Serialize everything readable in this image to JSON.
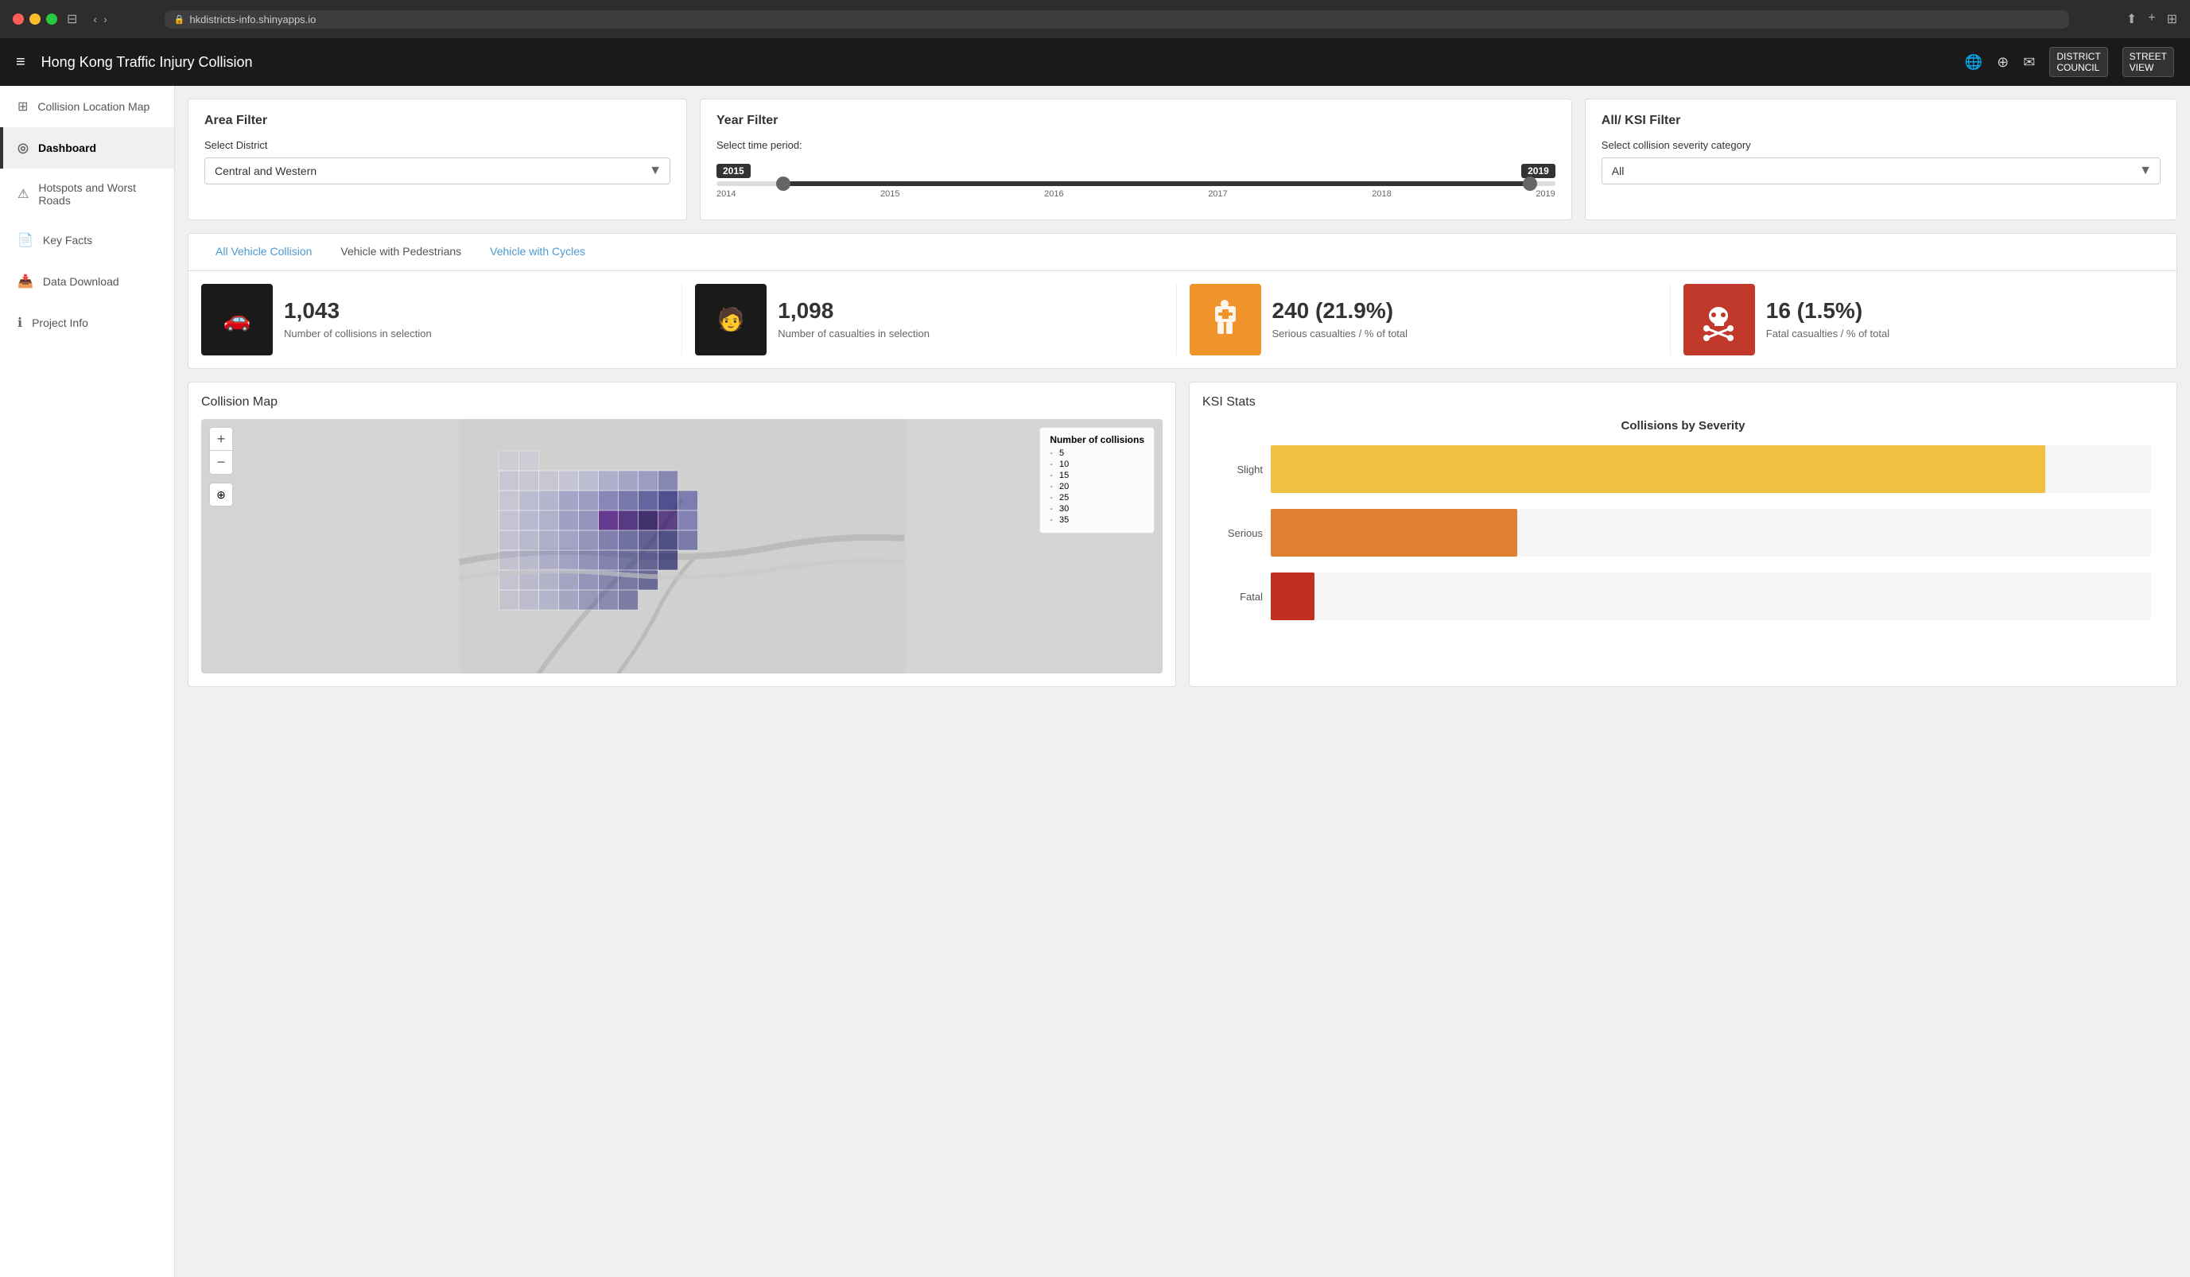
{
  "browser": {
    "url": "hkdistricts-info.shinyapps.io",
    "back_label": "‹",
    "forward_label": "›"
  },
  "topbar": {
    "title": "Hong Kong Traffic Injury Collision",
    "hamburger": "≡"
  },
  "sidebar": {
    "items": [
      {
        "id": "collision-location-map",
        "label": "Collision Location Map",
        "icon": "⊞",
        "active": false
      },
      {
        "id": "dashboard",
        "label": "Dashboard",
        "icon": "◎",
        "active": true
      },
      {
        "id": "hotspots",
        "label": "Hotspots and Worst Roads",
        "icon": "⚠",
        "active": false
      },
      {
        "id": "key-facts",
        "label": "Key Facts",
        "icon": "📄",
        "active": false
      },
      {
        "id": "data-download",
        "label": "Data Download",
        "icon": "📥",
        "active": false
      },
      {
        "id": "project-info",
        "label": "Project Info",
        "icon": "ℹ",
        "active": false
      }
    ]
  },
  "filters": {
    "area": {
      "title": "Area Filter",
      "label": "Select District",
      "selected": "Central and Western"
    },
    "year": {
      "title": "Year Filter",
      "label": "Select time period:",
      "from": "2015",
      "to": "2019",
      "ticks": [
        "2014",
        "2015",
        "2016",
        "2017",
        "2018",
        "2019"
      ]
    },
    "ksi": {
      "title": "All/ KSI Filter",
      "label": "Select collision severity category",
      "selected": "All"
    }
  },
  "tabs": [
    {
      "id": "all-vehicle",
      "label": "All Vehicle Collision",
      "active": true
    },
    {
      "id": "pedestrians",
      "label": "Vehicle with Pedestrians",
      "active": false
    },
    {
      "id": "cycles",
      "label": "Vehicle with Cycles",
      "active": false
    }
  ],
  "stats": [
    {
      "id": "collisions",
      "number": "1,043",
      "desc": "Number of collisions in selection",
      "icon": "🚗",
      "icon_type": "dark"
    },
    {
      "id": "casualties",
      "number": "1,098",
      "desc": "Number of casualties in selection",
      "icon": "🧑",
      "icon_type": "dark"
    },
    {
      "id": "serious",
      "number": "240 (21.9%)",
      "desc": "Serious casualties / % of total",
      "icon": "🏥",
      "icon_type": "orange"
    },
    {
      "id": "fatal",
      "number": "16 (1.5%)",
      "desc": "Fatal casualties / % of total",
      "icon": "💀",
      "icon_type": "red"
    }
  ],
  "map_panel": {
    "title": "Collision Map",
    "legend_title": "Number of collisions",
    "legend_items": [
      "5",
      "10",
      "15",
      "20",
      "25",
      "30",
      "35"
    ]
  },
  "chart_panel": {
    "title": "KSI Stats",
    "chart_title": "Collisions by Severity",
    "bars": [
      {
        "label": "Slight",
        "width_pct": 88,
        "color": "#f0c040"
      },
      {
        "label": "Serious",
        "width_pct": 28,
        "color": "#e08030"
      },
      {
        "label": "Fatal",
        "width_pct": 5,
        "color": "#c03020"
      }
    ]
  },
  "icons": {
    "search": "🔍",
    "globe": "🌐",
    "github": "⌥",
    "mail": "✉",
    "lock": "🔒",
    "layers": "⊕",
    "plus": "+",
    "minus": "−"
  }
}
